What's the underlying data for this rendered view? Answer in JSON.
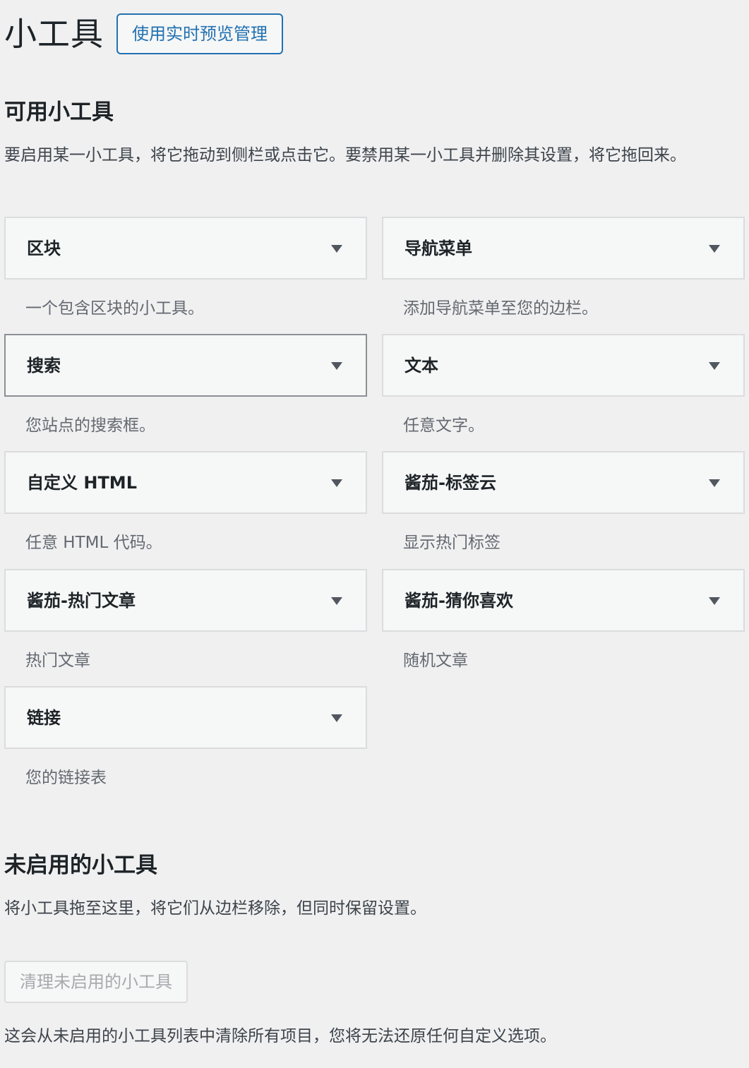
{
  "page": {
    "title": "小工具",
    "live_preview_button": "使用实时预览管理"
  },
  "available": {
    "heading": "可用小工具",
    "description": "要启用某一小工具，将它拖动到侧栏或点击它。要禁用某一小工具并删除其设置，将它拖回来。",
    "widgets": [
      {
        "title": "区块",
        "description": "一个包含区块的小工具。"
      },
      {
        "title": "导航菜单",
        "description": "添加导航菜单至您的边栏。"
      },
      {
        "title": "搜索",
        "description": "您站点的搜索框。"
      },
      {
        "title": "文本",
        "description": "任意文字。"
      },
      {
        "title": "自定义 HTML",
        "description": "任意 HTML 代码。"
      },
      {
        "title": "酱茄-标签云",
        "description": "显示热门标签"
      },
      {
        "title": "酱茄-热门文章",
        "description": "热门文章"
      },
      {
        "title": "酱茄-猜你喜欢",
        "description": "随机文章"
      },
      {
        "title": "链接",
        "description": "您的链接表"
      }
    ]
  },
  "inactive": {
    "heading": "未启用的小工具",
    "description": "将小工具拖至这里，将它们从边栏移除，但同时保留设置。",
    "clear_button": "清理未启用的小工具",
    "clear_note": "这会从未启用的小工具列表中清除所有项目，您将无法还原任何自定义选项。"
  }
}
